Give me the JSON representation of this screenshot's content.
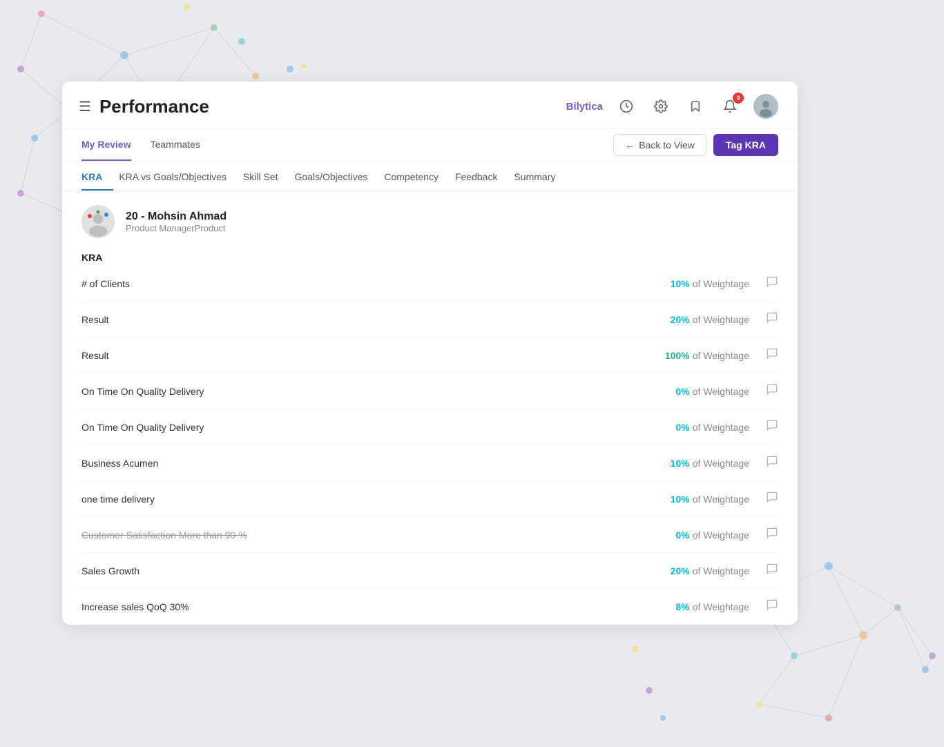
{
  "header": {
    "menu_label": "☰",
    "title": "Performance",
    "brand": "Bilytica",
    "notif_count": "0"
  },
  "sub_nav": {
    "items": [
      {
        "label": "My Review",
        "active": true
      },
      {
        "label": "Teammates",
        "active": false
      }
    ],
    "back_button": "Back to View",
    "tag_kra_button": "Tag KRA"
  },
  "tabs": [
    {
      "label": "KRA",
      "active": true
    },
    {
      "label": "KRA vs Goals/Objectives",
      "active": false
    },
    {
      "label": "Skill Set",
      "active": false
    },
    {
      "label": "Goals/Objectives",
      "active": false
    },
    {
      "label": "Competency",
      "active": false
    },
    {
      "label": "Feedback",
      "active": false
    },
    {
      "label": "Summary",
      "active": false
    }
  ],
  "employee": {
    "id": "20",
    "name": "20 - Mohsin Ahmad",
    "role": "Product ManagerProduct"
  },
  "kra_section": {
    "heading": "KRA",
    "rows": [
      {
        "name": "# of Clients",
        "pct": "10%",
        "suffix": "of Weightage",
        "color": "cyan"
      },
      {
        "name": "Result",
        "pct": "20%",
        "suffix": "of Weightage",
        "color": "cyan"
      },
      {
        "name": "Result",
        "pct": "100%",
        "suffix": "of Weightage",
        "color": "green"
      },
      {
        "name": "On Time On Quality Delivery",
        "pct": "0%",
        "suffix": "of Weightage",
        "color": "zero"
      },
      {
        "name": "On Time On Quality Delivery",
        "pct": "0%",
        "suffix": "of Weightage",
        "color": "zero"
      },
      {
        "name": "Business Acumen",
        "pct": "10%",
        "suffix": "of Weightage",
        "color": "cyan"
      },
      {
        "name": "one time delivery",
        "pct": "10%",
        "suffix": "of Weightage",
        "color": "cyan"
      },
      {
        "name": "Customer Satisfaction More than 90 %",
        "pct": "0%",
        "suffix": "of Weightage",
        "color": "zero",
        "faded": true
      },
      {
        "name": "Sales Growth",
        "pct": "20%",
        "suffix": "of Weightage",
        "color": "cyan"
      },
      {
        "name": "Increase sales QoQ 30%",
        "pct": "8%",
        "suffix": "of Weightage",
        "color": "cyan"
      }
    ]
  }
}
